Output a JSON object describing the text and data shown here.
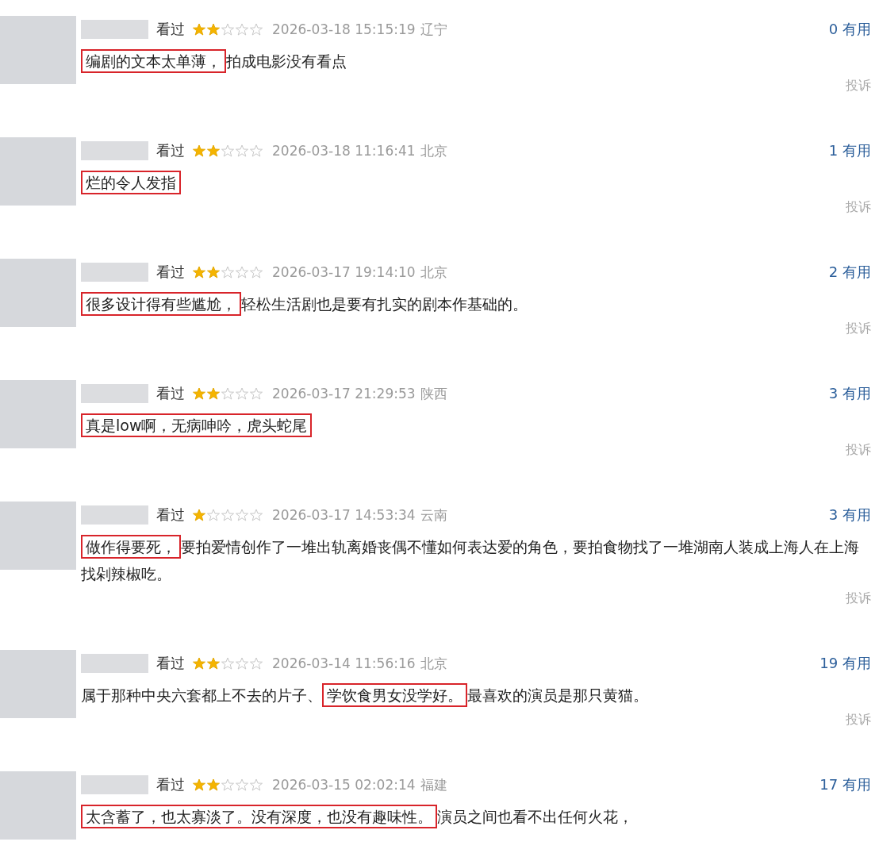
{
  "reviews": [
    {
      "status": "看过",
      "stars": 2,
      "time": "2026-03-18 15:15:19",
      "location": "辽宁",
      "useful": "0 有用",
      "segments": [
        {
          "text": "编剧的文本太单薄，",
          "highlighted": true
        },
        {
          "text": "拍成电影没有看点",
          "highlighted": false
        }
      ],
      "report": "投诉"
    },
    {
      "status": "看过",
      "stars": 2,
      "time": "2026-03-18 11:16:41",
      "location": "北京",
      "useful": "1 有用",
      "segments": [
        {
          "text": "烂的令人发指",
          "highlighted": true
        }
      ],
      "report": "投诉"
    },
    {
      "status": "看过",
      "stars": 2,
      "time": "2026-03-17 19:14:10",
      "location": "北京",
      "useful": "2 有用",
      "segments": [
        {
          "text": "很多设计得有些尴尬，",
          "highlighted": true
        },
        {
          "text": "轻松生活剧也是要有扎实的剧本作基础的。",
          "highlighted": false
        }
      ],
      "report": "投诉"
    },
    {
      "status": "看过",
      "stars": 2,
      "time": "2026-03-17 21:29:53",
      "location": "陕西",
      "useful": "3 有用",
      "segments": [
        {
          "text": "真是low啊，无病呻吟，虎头蛇尾",
          "highlighted": true
        }
      ],
      "report": "投诉"
    },
    {
      "status": "看过",
      "stars": 1,
      "time": "2026-03-17 14:53:34",
      "location": "云南",
      "useful": "3 有用",
      "segments": [
        {
          "text": "做作得要死，",
          "highlighted": true
        },
        {
          "text": "要拍爱情创作了一堆出轨离婚丧偶不懂如何表达爱的角色，要拍食物找了一堆湖南人装成上海人在上海找剁辣椒吃。",
          "highlighted": false
        }
      ],
      "report": "投诉"
    },
    {
      "status": "看过",
      "stars": 2,
      "time": "2026-03-14 11:56:16",
      "location": "北京",
      "useful": "19 有用",
      "segments": [
        {
          "text": "属于那种中央六套都上不去的片子、",
          "highlighted": false
        },
        {
          "text": "学饮食男女没学好。",
          "highlighted": true
        },
        {
          "text": "最喜欢的演员是那只黄猫。",
          "highlighted": false
        }
      ],
      "report": "投诉"
    },
    {
      "status": "看过",
      "stars": 2,
      "time": "2026-03-15 02:02:14",
      "location": "福建",
      "useful": "17 有用",
      "segments": [
        {
          "text": "太含蓄了，也太寡淡了。没有深度，也没有趣味性。",
          "highlighted": true
        },
        {
          "text": "演员之间也看不出任何火花，",
          "highlighted": false
        }
      ]
    }
  ]
}
